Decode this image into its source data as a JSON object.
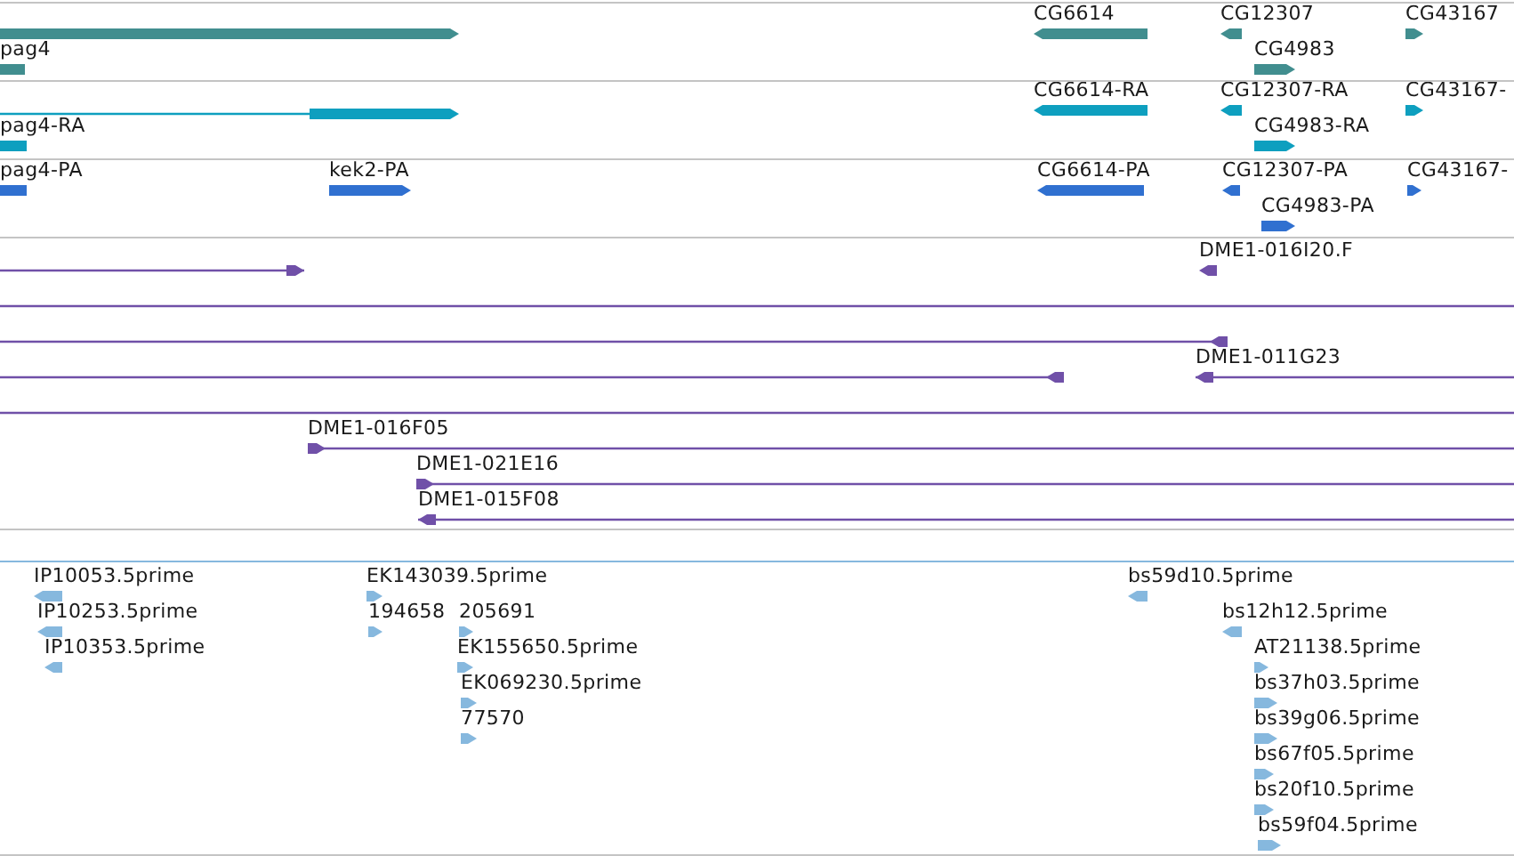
{
  "tracks": [
    {
      "color": "#418e8f",
      "features": [
        {
          "kind": "bar",
          "forward": true
        },
        {
          "label": "pag4",
          "kind": "bar",
          "forward": false
        },
        {
          "label": "CG6614",
          "kind": "bar",
          "forward": false
        },
        {
          "label": "CG12307",
          "kind": "bar",
          "forward": false
        },
        {
          "label": "CG43167",
          "kind": "bar",
          "forward": true
        },
        {
          "label": "CG4983",
          "kind": "bar",
          "forward": true
        }
      ]
    },
    {
      "color": "#0e9fbf",
      "features": [
        {
          "kind": "line_bar",
          "forward": true
        },
        {
          "label": "pag4-RA",
          "kind": "bar",
          "forward": false
        },
        {
          "label": "CG6614-RA",
          "kind": "bar",
          "forward": false
        },
        {
          "label": "CG12307-RA",
          "kind": "bar",
          "forward": false
        },
        {
          "label": "CG43167-",
          "kind": "bar",
          "forward": true
        },
        {
          "label": "CG4983-RA",
          "kind": "bar",
          "forward": true
        }
      ]
    },
    {
      "color": "#3070d0",
      "features": [
        {
          "label": "pag4-PA",
          "kind": "bar",
          "forward": false
        },
        {
          "label": "kek2-PA",
          "kind": "bar",
          "forward": true
        },
        {
          "label": "CG6614-PA",
          "kind": "bar",
          "forward": false
        },
        {
          "label": "CG12307-PA",
          "kind": "bar",
          "forward": false
        },
        {
          "label": "CG43167-",
          "kind": "bar",
          "forward": true
        },
        {
          "label": "CG4983-PA",
          "kind": "bar",
          "forward": true
        }
      ]
    },
    {
      "color": "#7050a8",
      "features": [
        {
          "kind": "line",
          "forward": true
        },
        {
          "label": "DME1-016I20.F",
          "kind": "bar",
          "forward": false
        },
        {
          "kind": "line"
        },
        {
          "kind": "line",
          "forward": false
        },
        {
          "kind": "line",
          "forward": false
        },
        {
          "label": "DME1-011G23",
          "kind": "line",
          "forward": false
        },
        {
          "kind": "line"
        },
        {
          "label": "DME1-016F05",
          "kind": "line",
          "forward": true
        },
        {
          "label": "DME1-021E16",
          "kind": "line",
          "forward": true
        },
        {
          "label": "DME1-015F08",
          "kind": "line",
          "forward": false
        }
      ]
    },
    {
      "color": "#86b8de",
      "features": [
        {
          "label": "IP10053.5prime",
          "kind": "bar",
          "forward": false
        },
        {
          "label": "EK143039.5prime",
          "kind": "bar",
          "forward": true
        },
        {
          "label": "bs59d10.5prime",
          "kind": "bar",
          "forward": false
        },
        {
          "label": "IP10253.5prime",
          "kind": "bar",
          "forward": false
        },
        {
          "label": "194658",
          "kind": "bar",
          "forward": true
        },
        {
          "label": "205691",
          "kind": "bar",
          "forward": true
        },
        {
          "label": "bs12h12.5prime",
          "kind": "bar",
          "forward": false
        },
        {
          "label": "IP10353.5prime",
          "kind": "bar",
          "forward": false
        },
        {
          "label": "EK155650.5prime",
          "kind": "bar",
          "forward": true
        },
        {
          "label": "AT21138.5prime",
          "kind": "bar",
          "forward": true
        },
        {
          "label": "EK069230.5prime",
          "kind": "bar",
          "forward": true
        },
        {
          "label": "bs37h03.5prime",
          "kind": "bar",
          "forward": true
        },
        {
          "label": "77570",
          "kind": "bar",
          "forward": true
        },
        {
          "label": "bs39g06.5prime",
          "kind": "bar",
          "forward": true
        },
        {
          "label": "bs67f05.5prime",
          "kind": "bar",
          "forward": true
        },
        {
          "label": "bs20f10.5prime",
          "kind": "bar",
          "forward": true
        },
        {
          "label": "bs59f04.5prime",
          "kind": "bar",
          "forward": true
        }
      ]
    }
  ]
}
